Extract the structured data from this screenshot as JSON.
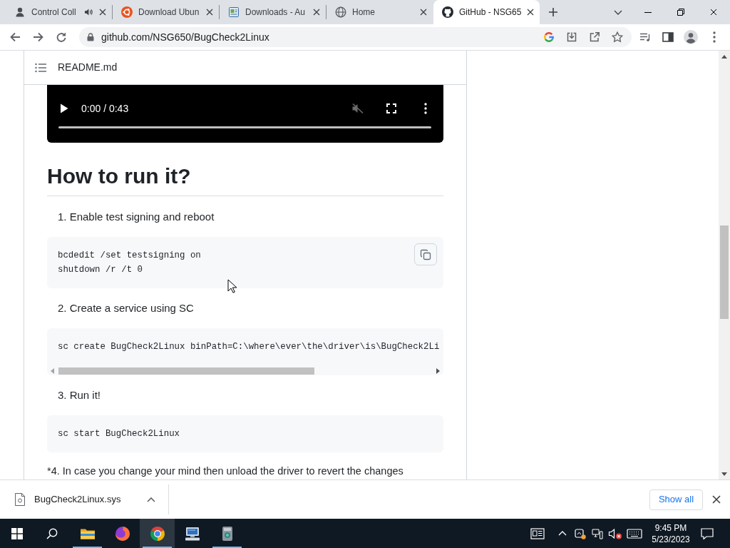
{
  "tabs": [
    {
      "title": "Control Coll",
      "selected": false,
      "audio": true
    },
    {
      "title": "Download Ubun",
      "selected": false,
      "audio": false
    },
    {
      "title": "Downloads - Au",
      "selected": false,
      "audio": false
    },
    {
      "title": "Home",
      "selected": false,
      "audio": false
    },
    {
      "title": "GitHub - NSG65",
      "selected": true,
      "audio": false
    }
  ],
  "address_bar": {
    "url": "github.com/NSG650/BugCheck2Linux"
  },
  "readme": {
    "title": "README.md",
    "video": {
      "time": "0:00 / 0:43",
      "muted": true
    },
    "heading": "How to run it?",
    "blocks": [
      {
        "kind": "step",
        "text": "1. Enable test signing and reboot"
      },
      {
        "kind": "code",
        "lines": [
          "bcdedit /set testsigning on",
          "shutdown /r /t 0"
        ],
        "copy_button": true,
        "scrollable": false
      },
      {
        "kind": "step",
        "text": "2. Create a service using SC"
      },
      {
        "kind": "code",
        "lines": [
          "sc create BugCheck2Linux binPath=C:\\where\\ever\\the\\driver\\is\\BugCheck2Li"
        ],
        "copy_button": false,
        "scrollable": true
      },
      {
        "kind": "step",
        "text": "3. Run it!"
      },
      {
        "kind": "code",
        "lines": [
          "sc start BugCheck2Linux"
        ],
        "copy_button": false,
        "scrollable": false
      },
      {
        "kind": "note",
        "text": "*4. In case you change your mind then unload the driver to revert the changes"
      }
    ]
  },
  "download_shelf": {
    "file": "BugCheck2Linux.sys",
    "show_all": "Show all"
  },
  "taskbar": {
    "apps": [
      {
        "running": true,
        "selected": false
      },
      {
        "running": false,
        "selected": false
      },
      {
        "running": true,
        "selected": true
      },
      {
        "running": false,
        "selected": false
      },
      {
        "running": true,
        "selected": false
      }
    ],
    "volume_muted": true,
    "time": "9:45 PM",
    "date": "5/23/2023"
  }
}
